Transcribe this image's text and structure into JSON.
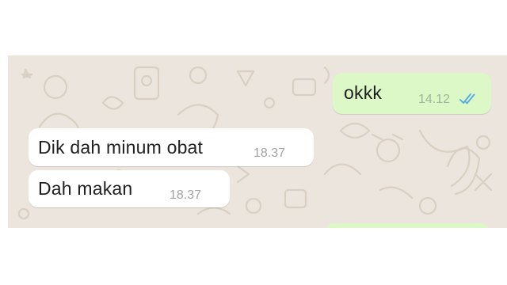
{
  "conversation": {
    "messages": [
      {
        "direction": "outgoing",
        "text": "okkk",
        "time": "14.12",
        "status_icon": "double-check-read-icon"
      },
      {
        "direction": "incoming",
        "text": "Dik dah minum obat",
        "time": "18.37"
      },
      {
        "direction": "incoming",
        "text": "Dah makan",
        "time": "18.37"
      }
    ]
  },
  "colors": {
    "wallpaper": "#ece5dd",
    "incoming_bubble": "#ffffff",
    "outgoing_bubble": "#dcf8c6",
    "read_ticks": "#4fa9e6"
  }
}
